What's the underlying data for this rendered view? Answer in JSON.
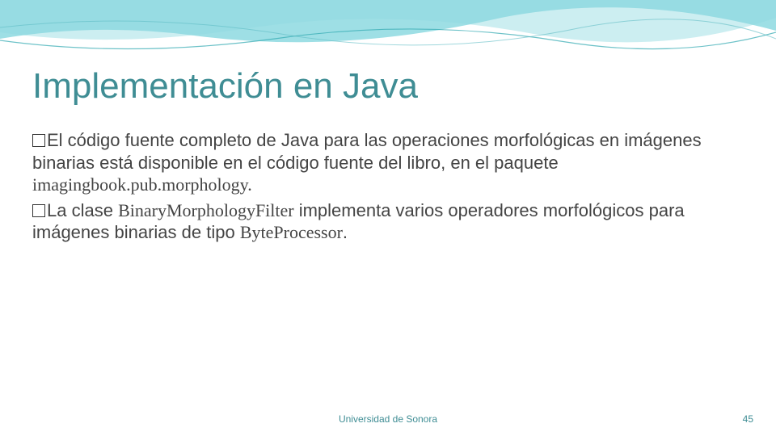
{
  "title": "Implementación en Java",
  "bullets": [
    {
      "lead": "El código fuente completo de Java para las operaciones morfológicas ",
      "rest1": "en imágenes binarias está disponible en el código fuente del libro, en el ",
      "rest2": "paquete ",
      "code": "imagingbook.pub.morphology."
    },
    {
      "lead1": "La clase ",
      "code1": "BinaryMorphologyFilter",
      "mid": " implementa varios operadores ",
      "rest": "morfológicos para imágenes binarias de tipo ",
      "code2": "ByteProcessor",
      "period": "."
    }
  ],
  "footer": {
    "center": "Universidad de Sonora",
    "page": "45"
  },
  "colors": {
    "accent": "#3f8d94",
    "wave_primary": "#4fc4cf",
    "wave_secondary": "#8fd9df"
  }
}
